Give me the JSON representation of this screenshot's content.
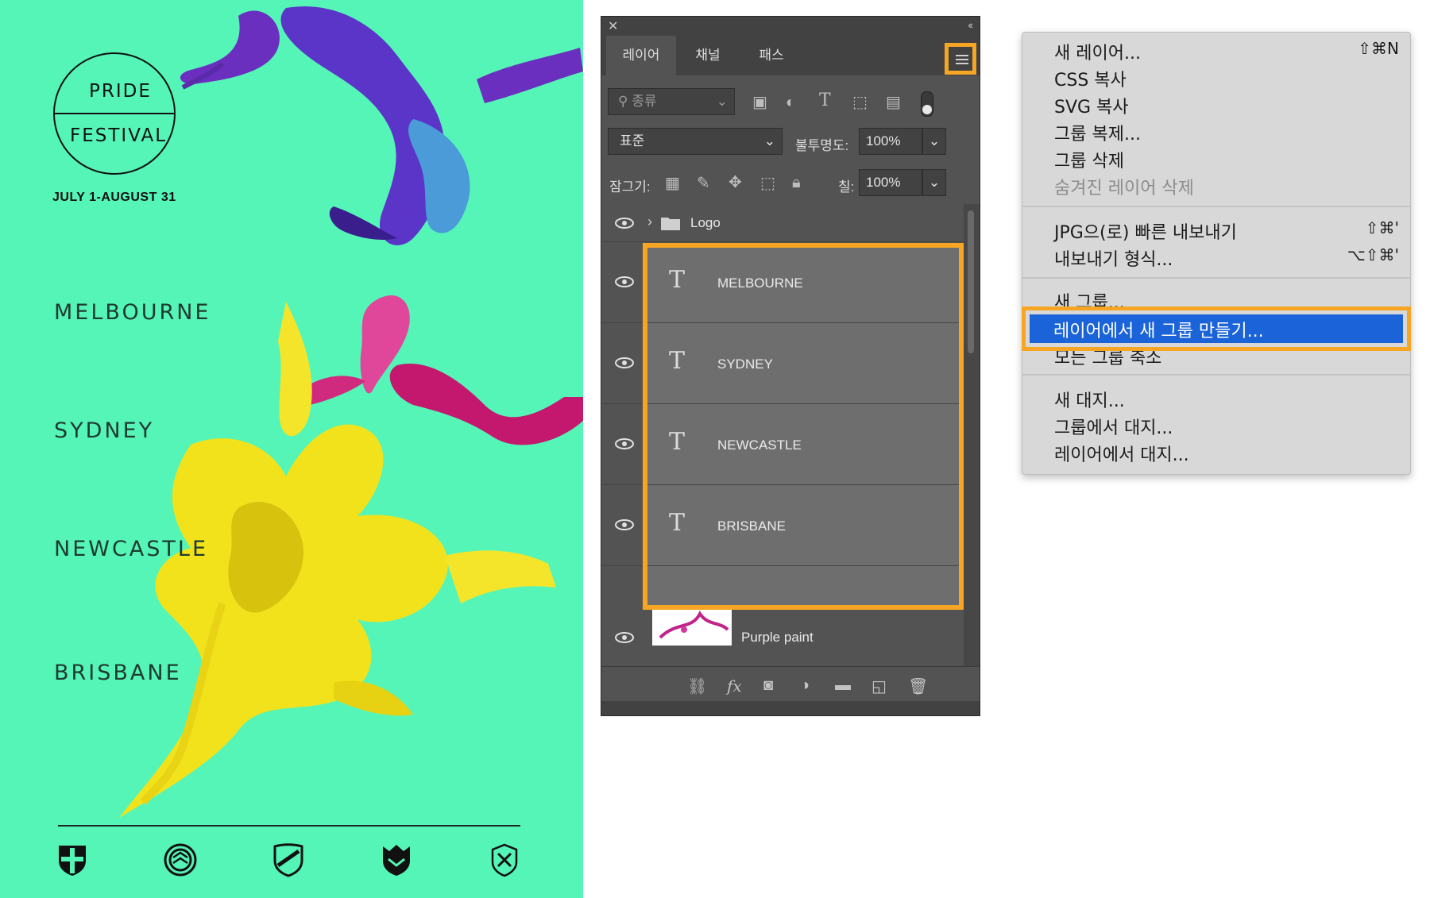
{
  "poster": {
    "logo_line1": "PRIDE",
    "logo_line2": "FESTIVAL",
    "dates": "JULY 1-AUGUST 31",
    "cities": [
      "MELBOURNE",
      "SYDNEY",
      "NEWCASTLE",
      "BRISBANE"
    ],
    "background_color": "#55f5b7"
  },
  "panel": {
    "tabs": [
      "레이어",
      "채널",
      "패스"
    ],
    "filter_placeholder": "종류",
    "blend_mode": "표준",
    "opacity_label": "불투명도:",
    "opacity_value": "100%",
    "lock_label": "잠그기:",
    "fill_label": "칠:",
    "fill_value": "100%",
    "layers": [
      {
        "name": "Logo",
        "type": "group"
      },
      {
        "name": "MELBOURNE",
        "type": "text"
      },
      {
        "name": "SYDNEY",
        "type": "text"
      },
      {
        "name": "NEWCASTLE",
        "type": "text"
      },
      {
        "name": "BRISBANE",
        "type": "text"
      },
      {
        "name": "Purple paint",
        "type": "image"
      }
    ],
    "accent_color": "#f6a624"
  },
  "menu": {
    "items": [
      {
        "label": "새 레이어...",
        "shortcut": "⇧⌘N"
      },
      {
        "label": "CSS 복사",
        "shortcut": ""
      },
      {
        "label": "SVG 복사",
        "shortcut": ""
      },
      {
        "label": "그룹 복제...",
        "shortcut": ""
      },
      {
        "label": "그룹 삭제",
        "shortcut": ""
      },
      {
        "label": "숨겨진 레이어 삭제",
        "shortcut": ""
      },
      {
        "label": "JPG으(로) 빠른 내보내기",
        "shortcut": "⇧⌘'"
      },
      {
        "label": "내보내기 형식...",
        "shortcut": "⌥⇧⌘'"
      },
      {
        "label": "새 그룹...",
        "shortcut": ""
      },
      {
        "label": "레이어에서 새 그룹 만들기...",
        "shortcut": ""
      },
      {
        "label": "모든 그룹 축소",
        "shortcut": ""
      },
      {
        "label": "새 대지...",
        "shortcut": ""
      },
      {
        "label": "그룹에서 대지...",
        "shortcut": ""
      },
      {
        "label": "레이어에서 대지...",
        "shortcut": ""
      }
    ],
    "highlight_color": "#1a63d8"
  }
}
